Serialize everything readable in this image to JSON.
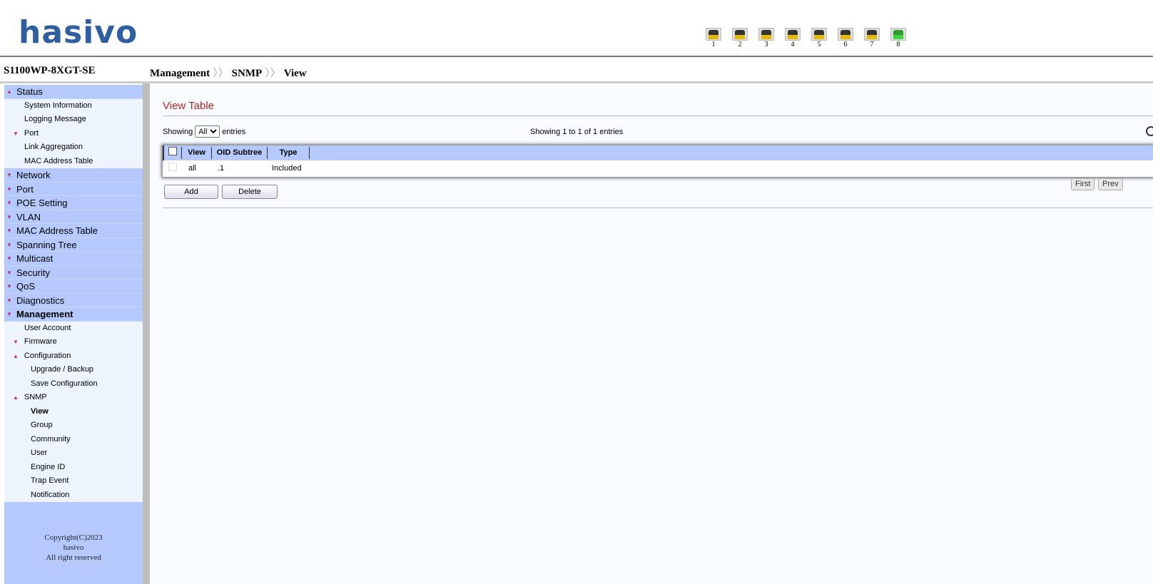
{
  "logo": "hasivo",
  "ports": [
    {
      "n": "1",
      "up": false
    },
    {
      "n": "2",
      "up": false
    },
    {
      "n": "3",
      "up": false
    },
    {
      "n": "4",
      "up": false
    },
    {
      "n": "5",
      "up": false
    },
    {
      "n": "6",
      "up": false
    },
    {
      "n": "7",
      "up": false
    },
    {
      "n": "8",
      "up": true
    }
  ],
  "model": "S1100WP-8XGT-SE",
  "breadcrumb": [
    "Management",
    "SNMP",
    "View"
  ],
  "breadcrumb_sep": "〉〉",
  "sidebar": [
    {
      "label": "Status",
      "level": 0,
      "arrow": "up"
    },
    {
      "label": "System Information",
      "level": 1
    },
    {
      "label": "Logging Message",
      "level": 1
    },
    {
      "label": "Port",
      "level": 1,
      "arrow": "down"
    },
    {
      "label": "Link Aggregation",
      "level": 1
    },
    {
      "label": "MAC Address Table",
      "level": 1
    },
    {
      "label": "Network",
      "level": 0,
      "arrow": "down"
    },
    {
      "label": "Port",
      "level": 0,
      "arrow": "down"
    },
    {
      "label": "POE Setting",
      "level": 0,
      "arrow": "down"
    },
    {
      "label": "VLAN",
      "level": 0,
      "arrow": "down"
    },
    {
      "label": "MAC Address Table",
      "level": 0,
      "arrow": "down"
    },
    {
      "label": "Spanning Tree",
      "level": 0,
      "arrow": "down"
    },
    {
      "label": "Multicast",
      "level": 0,
      "arrow": "down"
    },
    {
      "label": "Security",
      "level": 0,
      "arrow": "down"
    },
    {
      "label": "QoS",
      "level": 0,
      "arrow": "down"
    },
    {
      "label": "Diagnostics",
      "level": 0,
      "arrow": "down"
    },
    {
      "label": "Management",
      "level": 0,
      "arrow": "down",
      "bold": true
    },
    {
      "label": "User Account",
      "level": 1
    },
    {
      "label": "Firmware",
      "level": 1,
      "arrow": "down"
    },
    {
      "label": "Configuration",
      "level": 1,
      "arrow": "up"
    },
    {
      "label": "Upgrade / Backup",
      "level": 2
    },
    {
      "label": "Save Configuration",
      "level": 2
    },
    {
      "label": "SNMP",
      "level": 1,
      "arrow": "up"
    },
    {
      "label": "View",
      "level": 2,
      "bold": true
    },
    {
      "label": "Group",
      "level": 2
    },
    {
      "label": "Community",
      "level": 2
    },
    {
      "label": "User",
      "level": 2
    },
    {
      "label": "Engine ID",
      "level": 2
    },
    {
      "label": "Trap Event",
      "level": 2
    },
    {
      "label": "Notification",
      "level": 2
    }
  ],
  "footer": [
    "Copyright(C)2023",
    "hasivo",
    "All right reserved"
  ],
  "main": {
    "title": "View Table",
    "showing_prefix": "Showing",
    "showing_value": "All",
    "showing_suffix": "entries",
    "count": "Showing 1 to 1 of 1 entries",
    "columns": [
      "View",
      "OID Subtree",
      "Type"
    ],
    "rows": [
      [
        "all",
        ".1",
        "Included"
      ]
    ],
    "add": "Add",
    "delete": "Delete",
    "first": "First",
    "prev": "Prev"
  }
}
